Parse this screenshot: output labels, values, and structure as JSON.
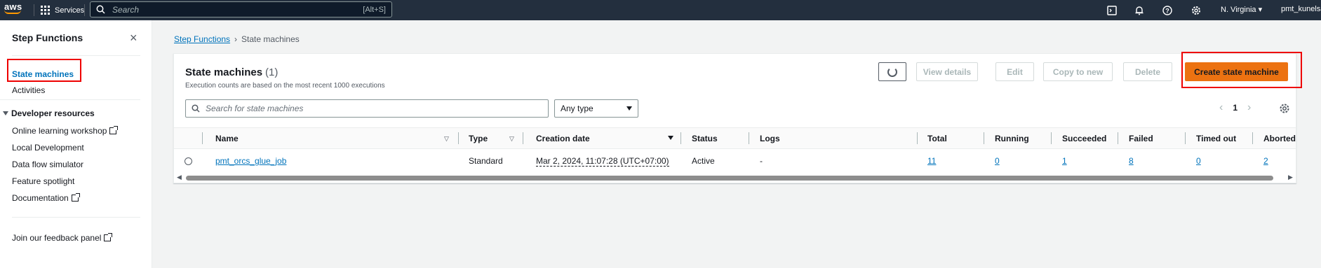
{
  "topnav": {
    "logo": "aws",
    "services": "Services",
    "search_placeholder": "Search",
    "search_shortcut": "[Alt+S]",
    "icons": [
      "cloudshell-icon",
      "notifications-icon",
      "help-icon",
      "settings-icon"
    ],
    "region": "N. Virginia",
    "account": "pmt_kunelsa"
  },
  "sidebar": {
    "title": "Step Functions",
    "items": [
      {
        "label": "State machines",
        "active": true
      },
      {
        "label": "Activities"
      }
    ],
    "section": "Developer resources",
    "resources": [
      {
        "label": "Online learning workshop",
        "external": true
      },
      {
        "label": "Local Development"
      },
      {
        "label": "Data flow simulator"
      },
      {
        "label": "Feature spotlight"
      },
      {
        "label": "Documentation",
        "external": true
      }
    ],
    "feedback": "Join our feedback panel"
  },
  "breadcrumb": {
    "root": "Step Functions",
    "current": "State machines"
  },
  "panel": {
    "title": "State machines",
    "count": "(1)",
    "description": "Execution counts are based on the most recent 1000 executions",
    "buttons": {
      "view_details": "View details",
      "edit": "Edit",
      "copy": "Copy to new",
      "delete": "Delete",
      "create": "Create state machine"
    },
    "filter_placeholder": "Search for state machines",
    "type_select": "Any type",
    "page": "1"
  },
  "table": {
    "columns": [
      "Name",
      "Type",
      "Creation date",
      "Status",
      "Logs",
      "Total",
      "Running",
      "Succeeded",
      "Failed",
      "Timed out",
      "Aborted"
    ],
    "rows": [
      {
        "name": "pmt_orcs_glue_job",
        "type": "Standard",
        "creation_date": "Mar 2, 2024, 11:07:28 (UTC+07:00)",
        "status": "Active",
        "logs": "-",
        "total": "11",
        "running": "0",
        "succeeded": "1",
        "failed": "8",
        "timed_out": "0",
        "aborted": "2"
      }
    ]
  },
  "colors": {
    "nav_bg": "#232f3e",
    "link": "#0073bb",
    "primary": "#ec7211",
    "highlight_box": "#ee0000"
  }
}
